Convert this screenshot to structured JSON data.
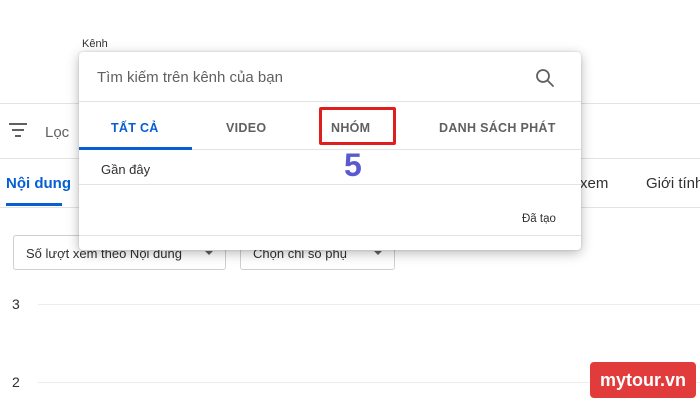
{
  "background": {
    "channel_label": "Kênh",
    "filter_label": "Lọc",
    "tabs": {
      "content": "Nội dung",
      "views_partial": "xem",
      "gender": "Giới tính"
    },
    "selects": {
      "metric": "Số lượt xem theo Nội dung",
      "secondary_metric": "Chọn chỉ số phụ"
    },
    "axis_labels": [
      "3",
      "2"
    ]
  },
  "popup": {
    "search_placeholder": "Tìm kiếm trên kênh của bạn",
    "tabs": [
      {
        "label": "TẤT CẢ",
        "active": true
      },
      {
        "label": "VIDEO",
        "active": false
      },
      {
        "label": "NHÓM",
        "active": false
      },
      {
        "label": "DANH SÁCH PHÁT",
        "active": false
      }
    ],
    "recent_label": "Gần đây",
    "created_label": "Đã tạo"
  },
  "annotation": {
    "step_number": "5",
    "highlight_color": "#e01e1e",
    "number_color": "#5a5ad0"
  },
  "watermark": {
    "text": "mytour.vn",
    "color": "#e23b3b"
  },
  "colors": {
    "accent": "#065fd4"
  }
}
